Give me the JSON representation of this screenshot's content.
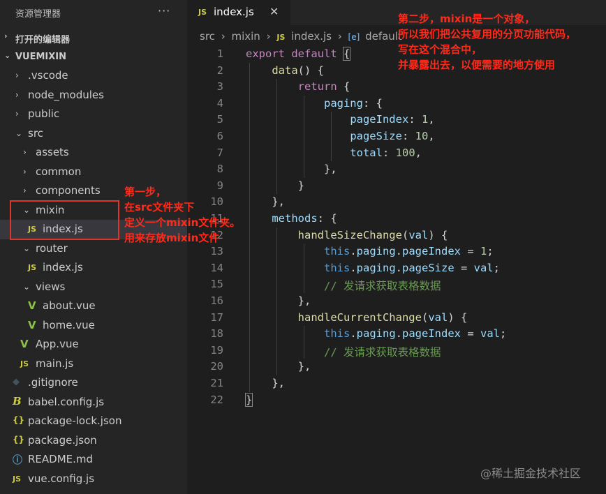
{
  "sidebar": {
    "title": "资源管理器",
    "more": "···",
    "open_editors": "打开的编辑器",
    "project": "VUEMIXIN"
  },
  "tree": [
    {
      "name": ".vscode",
      "depth": 1,
      "type": "folder",
      "expanded": false
    },
    {
      "name": "node_modules",
      "depth": 1,
      "type": "folder",
      "expanded": false
    },
    {
      "name": "public",
      "depth": 1,
      "type": "folder",
      "expanded": false
    },
    {
      "name": "src",
      "depth": 1,
      "type": "folder",
      "expanded": true
    },
    {
      "name": "assets",
      "depth": 2,
      "type": "folder",
      "expanded": false
    },
    {
      "name": "common",
      "depth": 2,
      "type": "folder",
      "expanded": false
    },
    {
      "name": "components",
      "depth": 2,
      "type": "folder",
      "expanded": false
    },
    {
      "name": "mixin",
      "depth": 2,
      "type": "folder",
      "expanded": true
    },
    {
      "name": "index.js",
      "depth": 3,
      "type": "js",
      "selected": true
    },
    {
      "name": "router",
      "depth": 2,
      "type": "folder",
      "expanded": true
    },
    {
      "name": "index.js",
      "depth": 3,
      "type": "js"
    },
    {
      "name": "views",
      "depth": 2,
      "type": "folder",
      "expanded": true
    },
    {
      "name": "about.vue",
      "depth": 3,
      "type": "vue"
    },
    {
      "name": "home.vue",
      "depth": 3,
      "type": "vue"
    },
    {
      "name": "App.vue",
      "depth": 2,
      "type": "vue"
    },
    {
      "name": "main.js",
      "depth": 2,
      "type": "js"
    },
    {
      "name": ".gitignore",
      "depth": 1,
      "type": "git"
    },
    {
      "name": "babel.config.js",
      "depth": 1,
      "type": "babel"
    },
    {
      "name": "package-lock.json",
      "depth": 1,
      "type": "json"
    },
    {
      "name": "package.json",
      "depth": 1,
      "type": "json"
    },
    {
      "name": "README.md",
      "depth": 1,
      "type": "info"
    },
    {
      "name": "vue.config.js",
      "depth": 1,
      "type": "js"
    }
  ],
  "icons": {
    "js": "JS",
    "vue": "V",
    "git": "◆",
    "babel": "B",
    "json": "{}",
    "info": "ⓘ",
    "chevron_right": "›",
    "chevron_down": "⌄",
    "close": "✕",
    "object": "[e]"
  },
  "tab": {
    "label": "index.js",
    "icon": "JS",
    "close": "✕"
  },
  "breadcrumb": [
    "src",
    "mixin",
    "index.js",
    "default"
  ],
  "code_lines": [
    [
      [
        "kw",
        "export"
      ],
      [
        "pun",
        " "
      ],
      [
        "kw",
        "default"
      ],
      [
        "pun",
        " "
      ],
      [
        "pun",
        "{"
      ]
    ],
    [
      [
        "pun",
        "    "
      ],
      [
        "fn",
        "data"
      ],
      [
        "pun",
        "() {"
      ]
    ],
    [
      [
        "pun",
        "        "
      ],
      [
        "kw",
        "return"
      ],
      [
        "pun",
        " {"
      ]
    ],
    [
      [
        "pun",
        "            "
      ],
      [
        "prop",
        "paging"
      ],
      [
        "pun",
        ": {"
      ]
    ],
    [
      [
        "pun",
        "                "
      ],
      [
        "prop",
        "pageIndex"
      ],
      [
        "pun",
        ": "
      ],
      [
        "num",
        "1"
      ],
      [
        "pun",
        ","
      ]
    ],
    [
      [
        "pun",
        "                "
      ],
      [
        "prop",
        "pageSize"
      ],
      [
        "pun",
        ": "
      ],
      [
        "num",
        "10"
      ],
      [
        "pun",
        ","
      ]
    ],
    [
      [
        "pun",
        "                "
      ],
      [
        "prop",
        "total"
      ],
      [
        "pun",
        ": "
      ],
      [
        "num",
        "100"
      ],
      [
        "pun",
        ","
      ]
    ],
    [
      [
        "pun",
        "            },"
      ]
    ],
    [
      [
        "pun",
        "        }"
      ]
    ],
    [
      [
        "pun",
        "    },"
      ]
    ],
    [
      [
        "pun",
        "    "
      ],
      [
        "prop",
        "methods"
      ],
      [
        "pun",
        ": {"
      ]
    ],
    [
      [
        "pun",
        "        "
      ],
      [
        "fn",
        "handleSizeChange"
      ],
      [
        "pun",
        "("
      ],
      [
        "prop",
        "val"
      ],
      [
        "pun",
        ") {"
      ]
    ],
    [
      [
        "pun",
        "            "
      ],
      [
        "kw2",
        "this"
      ],
      [
        "pun",
        "."
      ],
      [
        "prop",
        "paging"
      ],
      [
        "pun",
        "."
      ],
      [
        "prop",
        "pageIndex"
      ],
      [
        "pun",
        " = "
      ],
      [
        "num",
        "1"
      ],
      [
        "pun",
        ";"
      ]
    ],
    [
      [
        "pun",
        "            "
      ],
      [
        "kw2",
        "this"
      ],
      [
        "pun",
        "."
      ],
      [
        "prop",
        "paging"
      ],
      [
        "pun",
        "."
      ],
      [
        "prop",
        "pageSize"
      ],
      [
        "pun",
        " = "
      ],
      [
        "prop",
        "val"
      ],
      [
        "pun",
        ";"
      ]
    ],
    [
      [
        "pun",
        "            "
      ],
      [
        "cmt",
        "// 发请求获取表格数据"
      ]
    ],
    [
      [
        "pun",
        "        },"
      ]
    ],
    [
      [
        "pun",
        "        "
      ],
      [
        "fn",
        "handleCurrentChange"
      ],
      [
        "pun",
        "("
      ],
      [
        "prop",
        "val"
      ],
      [
        "pun",
        ") {"
      ]
    ],
    [
      [
        "pun",
        "            "
      ],
      [
        "kw2",
        "this"
      ],
      [
        "pun",
        "."
      ],
      [
        "prop",
        "paging"
      ],
      [
        "pun",
        "."
      ],
      [
        "prop",
        "pageIndex"
      ],
      [
        "pun",
        " = "
      ],
      [
        "prop",
        "val"
      ],
      [
        "pun",
        ";"
      ]
    ],
    [
      [
        "pun",
        "            "
      ],
      [
        "cmt",
        "// 发请求获取表格数据"
      ]
    ],
    [
      [
        "pun",
        "        },"
      ]
    ],
    [
      [
        "pun",
        "    },"
      ]
    ],
    [
      [
        "pun",
        "}"
      ]
    ]
  ],
  "annotations": {
    "step1": [
      "第一步，",
      "在src文件夹下",
      "定义一个mixin文件夹。",
      "用来存放mixin文件"
    ],
    "step2": [
      "第二步，mixin是一个对象，",
      "所以我们把公共复用的分页功能代码，",
      "写在这个混合中，",
      "并暴露出去，以便需要的地方使用"
    ]
  },
  "watermark": "@稀土掘金技术社区",
  "colors": {
    "annotation": "#ff2a1a",
    "sidebar_bg": "#252526",
    "editor_bg": "#1e1e1e",
    "selected_row": "#37373d"
  }
}
